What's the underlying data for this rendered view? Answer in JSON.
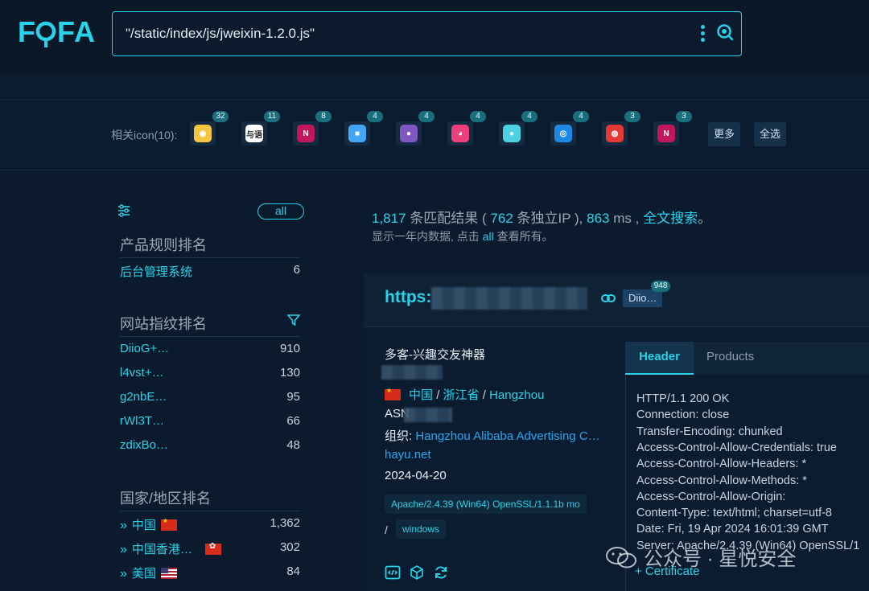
{
  "header": {
    "logo": "FOFA",
    "search_query": "\"/static/index/js/jweixin-1.2.0.js\""
  },
  "icon_row": {
    "label": "相关icon(10):",
    "icons": [
      {
        "name": "icon-1",
        "count": "32",
        "color": "#f5c542",
        "glyph": "◉"
      },
      {
        "name": "icon-2",
        "count": "11",
        "color": "#ffffff",
        "glyph": "与语"
      },
      {
        "name": "icon-3",
        "count": "8",
        "color": "#c2185b",
        "glyph": "N"
      },
      {
        "name": "icon-4",
        "count": "4",
        "color": "#42a5f5",
        "glyph": "■"
      },
      {
        "name": "icon-5",
        "count": "4",
        "color": "#7e57c2",
        "glyph": "●"
      },
      {
        "name": "icon-6",
        "count": "4",
        "color": "#ec407a",
        "glyph": "◕"
      },
      {
        "name": "icon-7",
        "count": "4",
        "color": "#4dd0e1",
        "glyph": "●"
      },
      {
        "name": "icon-8",
        "count": "4",
        "color": "#1e88e5",
        "glyph": "◎"
      },
      {
        "name": "icon-9",
        "count": "3",
        "color": "#e53935",
        "glyph": "◍"
      },
      {
        "name": "icon-10",
        "count": "3",
        "color": "#c2185b",
        "glyph": "N"
      }
    ],
    "more_label": "更多",
    "select_all_label": "全选"
  },
  "sidebar": {
    "all_label": "all",
    "product_title": "产品规则排名",
    "products": [
      {
        "label": "后台管理系统",
        "count": "6"
      }
    ],
    "fingerprint_title": "网站指纹排名",
    "fingerprints": [
      {
        "label": "DiioG+…",
        "count": "910"
      },
      {
        "label": "l4vst+…",
        "count": "130"
      },
      {
        "label": "g2nbE…",
        "count": "95"
      },
      {
        "label": "rWl3T…",
        "count": "66"
      },
      {
        "label": "zdixBo…",
        "count": "48"
      }
    ],
    "country_title": "国家/地区排名",
    "countries": [
      {
        "label": "中国",
        "count": "1,362"
      },
      {
        "label": "中国香港…",
        "count": "302"
      },
      {
        "label": "美国",
        "count": "84"
      }
    ]
  },
  "summary": {
    "total": "1,817",
    "total_suffix": "条匹配结果 (",
    "unique_ip": "762",
    "unique_suffix": "条独立IP ),",
    "time": "863",
    "time_suffix": "ms ,",
    "fulltext_link": "全文搜索",
    "period_end": "。",
    "line2_prefix": "显示一年内数据, 点击",
    "line2_link": "all",
    "line2_suffix": "查看所有。"
  },
  "result": {
    "url_prefix": "https:",
    "tag_label": "Diio…",
    "tag_count": "948",
    "title": "多客-兴趣交友神器",
    "country": "中国",
    "province": "浙江省",
    "city": "Hangzhou",
    "sep": "/",
    "asn_label": "ASN",
    "org_label": "组织:",
    "org_value": "Hangzhou Alibaba Advertising C…",
    "domain": "hayu.net",
    "date": "2024-04-20",
    "server_chip": "Apache/2.4.39 (Win64) OpenSSL/1.1.1b mo",
    "os_chip": "windows",
    "tabs": {
      "header": "Header",
      "products": "Products"
    },
    "headers": [
      "HTTP/1.1 200 OK",
      "Connection: close",
      "Transfer-Encoding: chunked",
      "Access-Control-Allow-Credentials: true",
      "Access-Control-Allow-Headers: *",
      "Access-Control-Allow-Methods: *",
      "Access-Control-Allow-Origin:",
      "Content-Type: text/html; charset=utf-8",
      "Date: Fri, 19 Apr 2024 16:01:39 GMT",
      "Server: Apache/2.4.39 (Win64) OpenSSL/1"
    ],
    "certificate_label": "+ Certificate"
  },
  "watermark": "公众号 · 星悦安全"
}
